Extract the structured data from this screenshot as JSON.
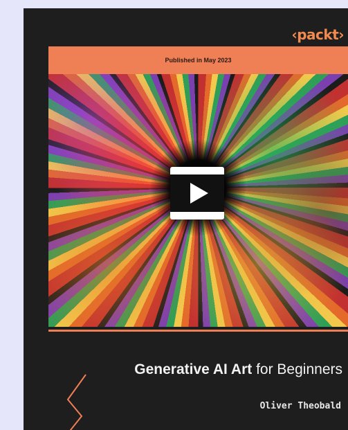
{
  "cover": {
    "brand": "‹packt›",
    "banner_text": "Published in May 2023",
    "title_strong": "Generative AI Art",
    "title_rest": " for Beginners",
    "author": "Oliver Theobald"
  },
  "icons": {
    "play": "video-play-icon",
    "chevron": "chevron-decoration-icon"
  },
  "colors": {
    "accent": "#ef7f55",
    "brand": "#f28a4e",
    "cover_bg": "#1e1e1e",
    "page_bg": "#e6e6fb"
  }
}
